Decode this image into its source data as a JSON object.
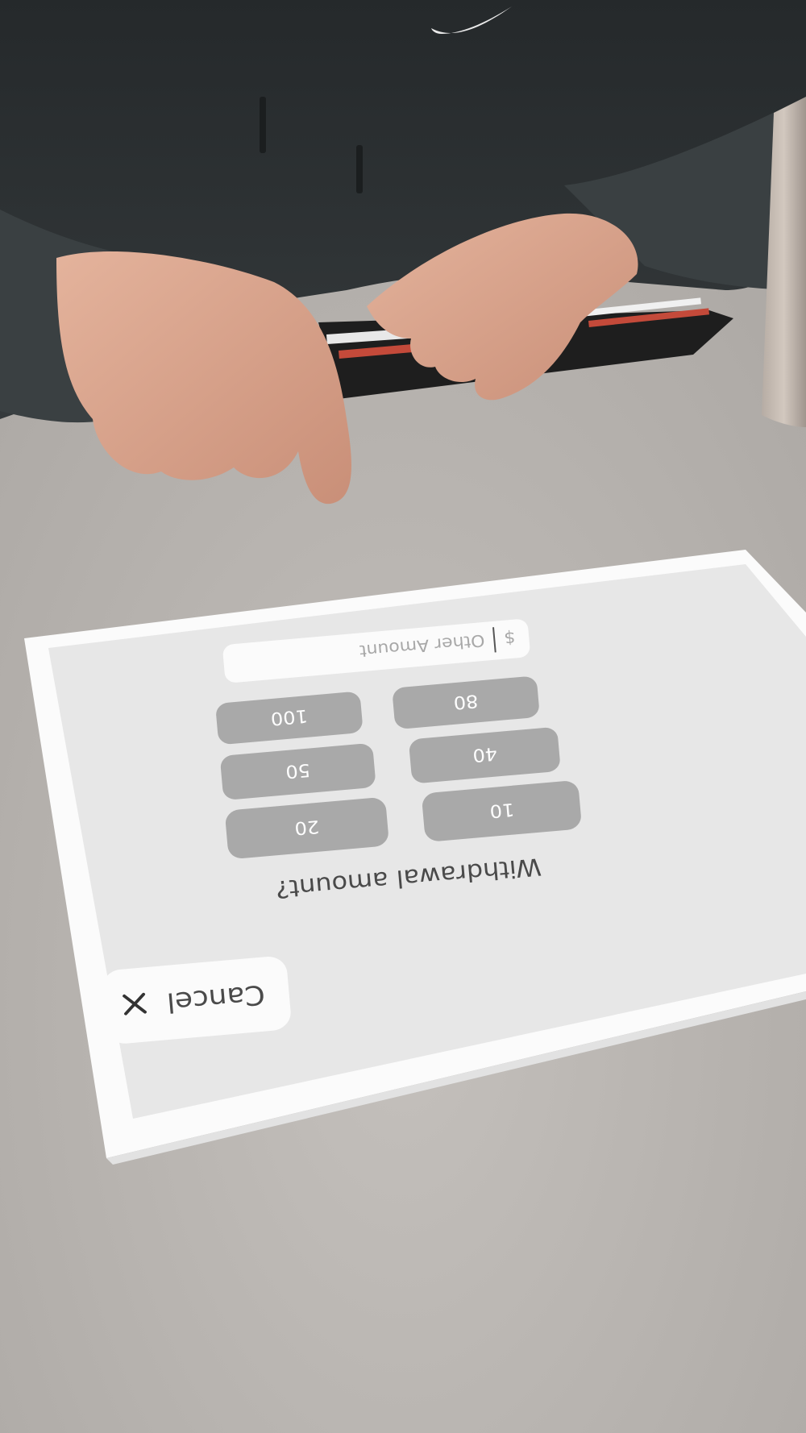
{
  "screen": {
    "title": "Withdrawal amount?",
    "other_amount": {
      "currency": "$",
      "placeholder": "Other Amount"
    },
    "amounts": [
      "80",
      "100",
      "40",
      "50",
      "10",
      "20"
    ],
    "cancel_label": "Cancel",
    "cancel_icon": "close-icon"
  },
  "colors": {
    "table": "#b9b5b1",
    "paper": "#fbfbfb",
    "screen_bg": "#e7e7e7",
    "button": "#a9a9a9",
    "hoodie": "#2c3133",
    "skin": "#d9a58e"
  }
}
